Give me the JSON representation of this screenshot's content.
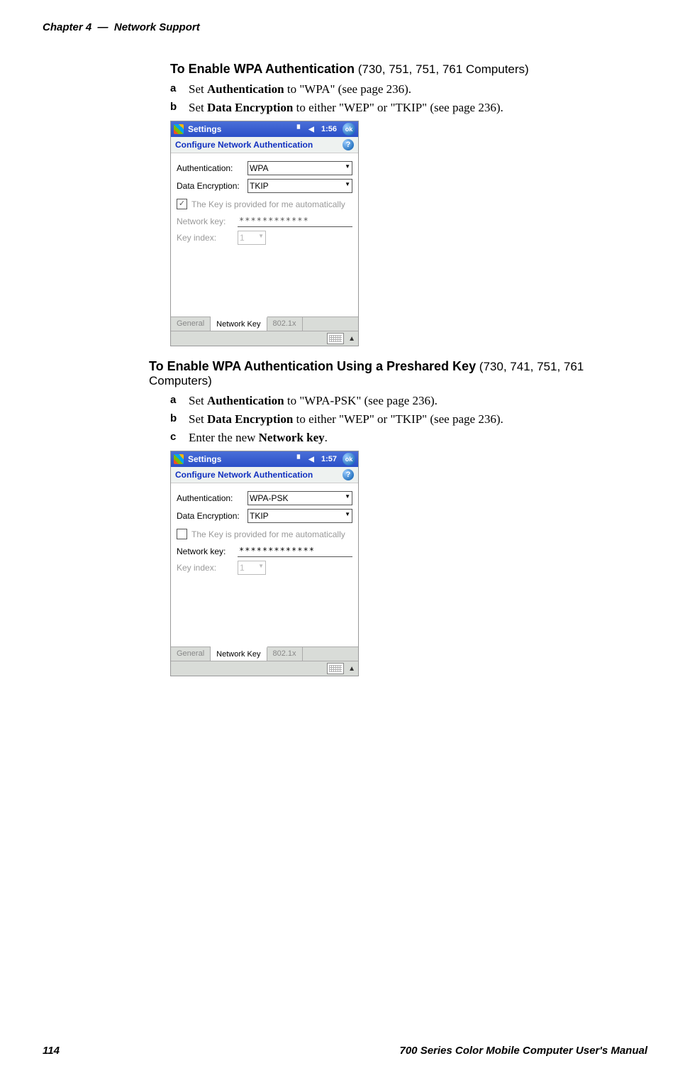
{
  "header": {
    "chapter": "Chapter 4",
    "sep": "—",
    "title": "Network Support"
  },
  "section1": {
    "heading_bold": "To Enable WPA Authentication",
    "heading_light": " (730, 751, 751, 761 Computers)",
    "step_a_marker": "a",
    "step_a_pre": "Set ",
    "step_a_bold": "Authentication",
    "step_a_post": " to \"WPA\" (see page 236).",
    "step_b_marker": "b",
    "step_b_pre": "Set ",
    "step_b_bold": "Data Encryption",
    "step_b_post": " to either \"WEP\" or \"TKIP\" (see page 236)."
  },
  "shot1": {
    "title": "Settings",
    "time": "1:56",
    "ok": "ok",
    "subtitle": "Configure Network Authentication",
    "help": "?",
    "auth_label": "Authentication:",
    "auth_value": "WPA",
    "enc_label": "Data Encryption:",
    "enc_value": "TKIP",
    "checkbox_checked": true,
    "checkbox_label": "The Key is provided for me automatically",
    "netkey_label": "Network key:",
    "netkey_value": "************",
    "keyidx_label": "Key index:",
    "keyidx_value": "1",
    "tabs": {
      "general": "General",
      "network_key": "Network Key",
      "dot1x": "802.1x"
    }
  },
  "section2": {
    "heading_bold": "To Enable WPA Authentication Using a Preshared Key",
    "heading_light": " (730, 741, 751, 761 Computers)",
    "step_a_marker": "a",
    "step_a_pre": "Set ",
    "step_a_bold": "Authentication",
    "step_a_post": " to \"WPA-PSK\" (see page 236).",
    "step_b_marker": "b",
    "step_b_pre": "Set ",
    "step_b_bold": "Data Encryption",
    "step_b_post": " to either \"WEP\" or \"TKIP\" (see page 236).",
    "step_c_marker": "c",
    "step_c_pre": "Enter the new ",
    "step_c_bold": "Network key",
    "step_c_post": "."
  },
  "shot2": {
    "title": "Settings",
    "time": "1:57",
    "ok": "ok",
    "subtitle": "Configure Network Authentication",
    "help": "?",
    "auth_label": "Authentication:",
    "auth_value": "WPA-PSK",
    "enc_label": "Data Encryption:",
    "enc_value": "TKIP",
    "checkbox_checked": false,
    "checkbox_label": "The Key is provided for me automatically",
    "netkey_label": "Network key:",
    "netkey_value": "*************",
    "keyidx_label": "Key index:",
    "keyidx_value": "1",
    "tabs": {
      "general": "General",
      "network_key": "Network Key",
      "dot1x": "802.1x"
    }
  },
  "footer": {
    "page": "114",
    "manual": "700 Series Color Mobile Computer User's Manual"
  },
  "glyphs": {
    "check": "✓",
    "speaker": "◀",
    "signal": "▝",
    "dropdown": "▼",
    "up": "▲"
  }
}
